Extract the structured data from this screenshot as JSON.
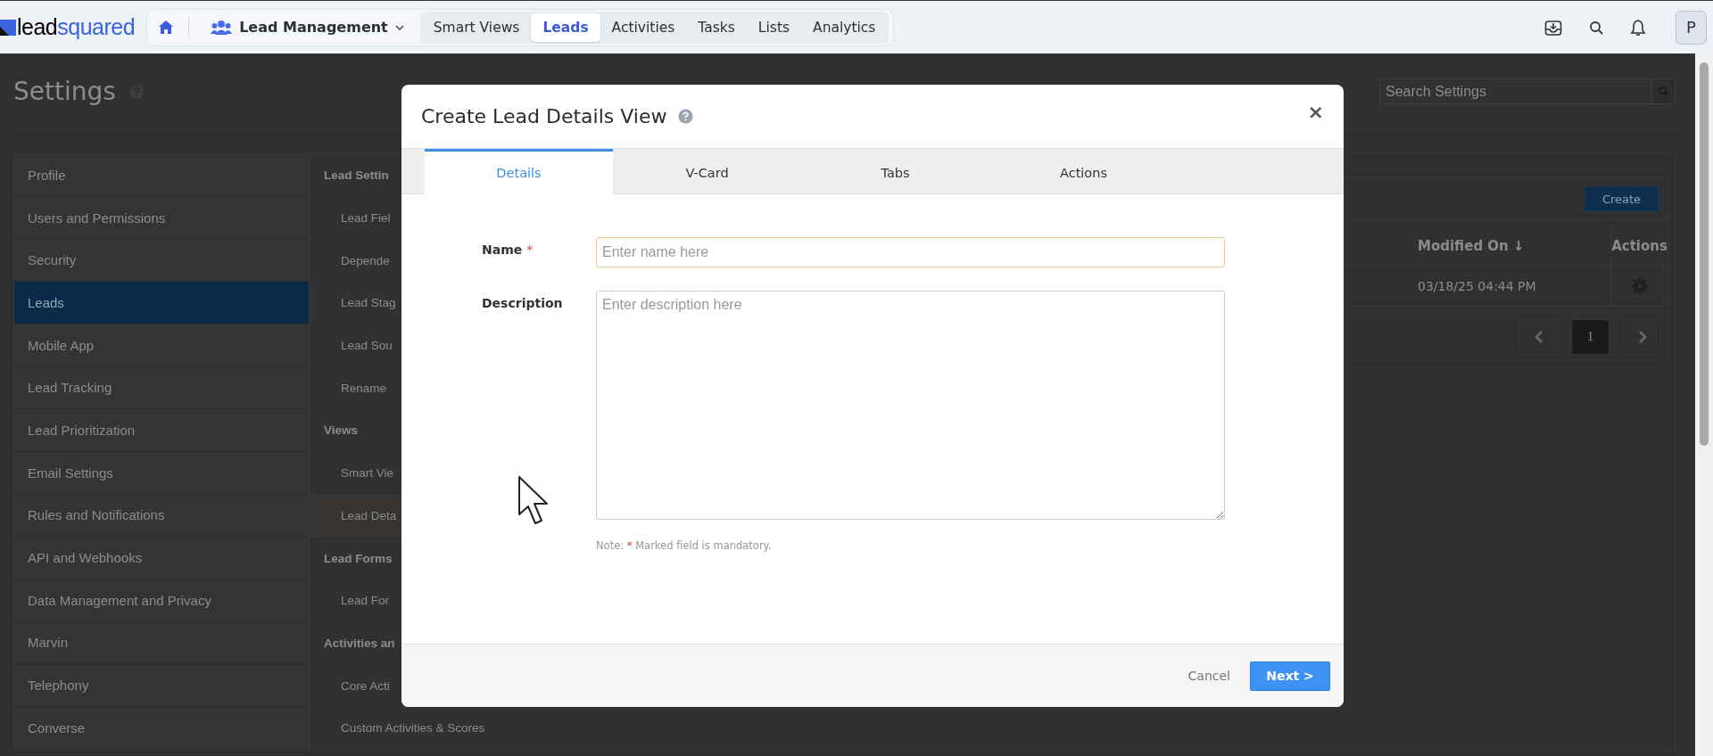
{
  "topbar": {
    "logo": {
      "part1": "lead",
      "part2": "squared"
    },
    "module": "Lead Management",
    "nav_tabs": [
      {
        "label": "Smart Views",
        "selected": false
      },
      {
        "label": "Leads",
        "selected": true
      },
      {
        "label": "Activities",
        "selected": false
      },
      {
        "label": "Tasks",
        "selected": false
      },
      {
        "label": "Lists",
        "selected": false
      },
      {
        "label": "Analytics",
        "selected": false
      }
    ],
    "avatar": "P"
  },
  "settings": {
    "title": "Settings",
    "search": {
      "placeholder": "Search Settings"
    },
    "sidebar": [
      {
        "label": "Profile",
        "selected": false
      },
      {
        "label": "Users and Permissions",
        "selected": false
      },
      {
        "label": "Security",
        "selected": false
      },
      {
        "label": "Leads",
        "selected": true
      },
      {
        "label": "Mobile App",
        "selected": false
      },
      {
        "label": "Lead Tracking",
        "selected": false
      },
      {
        "label": "Lead Prioritization",
        "selected": false
      },
      {
        "label": "Email Settings",
        "selected": false
      },
      {
        "label": "Rules and Notifications",
        "selected": false
      },
      {
        "label": "API and Webhooks",
        "selected": false
      },
      {
        "label": "Data Management and Privacy",
        "selected": false
      },
      {
        "label": "Marvin",
        "selected": false
      },
      {
        "label": "Telephony",
        "selected": false
      },
      {
        "label": "Converse",
        "selected": false
      }
    ],
    "submenu": [
      {
        "kind": "section",
        "label": "Lead Settin"
      },
      {
        "kind": "item",
        "label": "Lead Fiel",
        "selected": false
      },
      {
        "kind": "item",
        "label": "Depende",
        "selected": false
      },
      {
        "kind": "item",
        "label": "Lead Stag",
        "selected": false
      },
      {
        "kind": "item",
        "label": "Lead Sou",
        "selected": false
      },
      {
        "kind": "item",
        "label": "Rename",
        "selected": false
      },
      {
        "kind": "section",
        "label": "Views"
      },
      {
        "kind": "item",
        "label": "Smart Vie",
        "selected": false
      },
      {
        "kind": "item",
        "label": "Lead Deta",
        "selected": true
      },
      {
        "kind": "section",
        "label": "Lead Forms"
      },
      {
        "kind": "item",
        "label": "Lead For",
        "selected": false
      },
      {
        "kind": "section",
        "label": "Activities an"
      },
      {
        "kind": "item",
        "label": "Core Acti",
        "selected": false
      },
      {
        "kind": "item",
        "label": "Custom Activities & Scores",
        "selected": false
      }
    ],
    "create_button": "Create",
    "table": {
      "columns": [
        {
          "label": "Modified On",
          "sort": "↓"
        },
        {
          "label": "Actions"
        }
      ],
      "rows": [
        {
          "modified_on": "03/18/25 04:44 PM"
        }
      ]
    },
    "pagination": {
      "pages": [
        {
          "label": "1",
          "selected": true
        }
      ]
    }
  },
  "dialog": {
    "title": "Create Lead Details View",
    "close": "×",
    "tabs": [
      {
        "label": "Details",
        "selected": true
      },
      {
        "label": "V-Card",
        "selected": false
      },
      {
        "label": "Tabs",
        "selected": false
      },
      {
        "label": "Actions",
        "selected": false
      }
    ],
    "fields": [
      {
        "kind": "text",
        "label": "Name",
        "required_mark": "*",
        "placeholder": "Enter name here"
      },
      {
        "kind": "textarea",
        "label": "Description",
        "placeholder": "Enter description here"
      }
    ],
    "note": {
      "prefix": "Note:",
      "mark": "*",
      "text": "Marked field is mandatory."
    },
    "buttons": {
      "cancel": "Cancel",
      "next": "Next >"
    }
  }
}
